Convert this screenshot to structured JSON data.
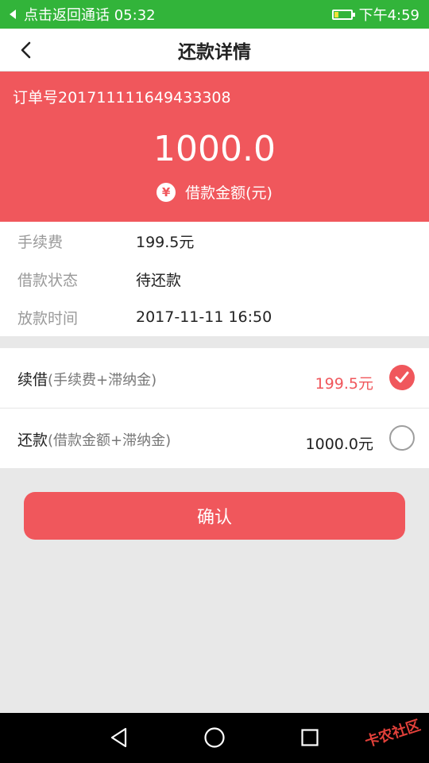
{
  "status_bar": {
    "call_text": "点击返回通话 05:32",
    "time": "下午4:59",
    "battery_level": 0.25
  },
  "header": {
    "title": "还款详情",
    "back_icon": "chevron-left-icon"
  },
  "order": {
    "order_no": "订单号201711111649433308",
    "amount": "1000.0",
    "amount_label": "借款金额(元)",
    "yen_symbol": "¥"
  },
  "info": [
    {
      "key": "手续费",
      "value": "199.5元"
    },
    {
      "key": "借款状态",
      "value": "待还款"
    },
    {
      "key": "放款时间",
      "value": "2017-11-11 16:50"
    }
  ],
  "options": [
    {
      "name": "续借",
      "sub": "(手续费+滞纳金)",
      "amount": "199.5元",
      "selected": true
    },
    {
      "name": "还款",
      "sub": "(借款金额+滞纳金)",
      "amount": "1000.0元",
      "selected": false
    }
  ],
  "confirm_label": "确认",
  "watermark": "卡农社区",
  "colors": {
    "accent": "#f0575c",
    "status_bar": "#32b43a",
    "background": "#e8e8e8"
  }
}
